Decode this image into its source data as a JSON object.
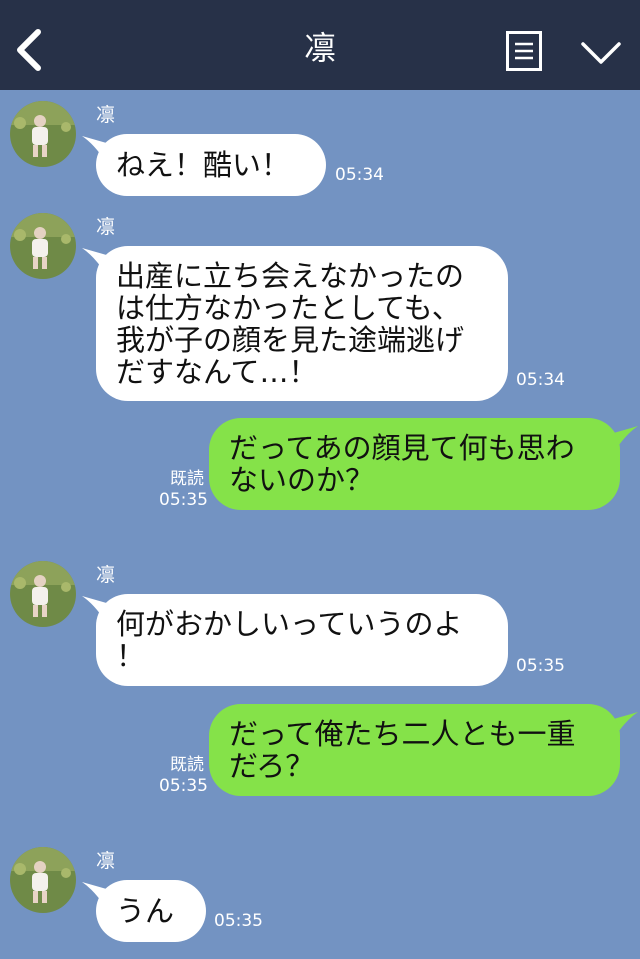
{
  "header": {
    "title": "凛",
    "back_icon": "chevron-left-icon",
    "menu_icon": "note-list-icon",
    "collapse_icon": "chevron-down-icon"
  },
  "colors": {
    "chat_background": "#7393c2",
    "header_background": "#273148",
    "incoming_bubble": "#ffffff",
    "outgoing_bubble": "#85e249"
  },
  "messages": [
    {
      "direction": "in",
      "sender": "凛",
      "text": "ねえ！酷い！",
      "time": "05:34"
    },
    {
      "direction": "in",
      "sender": "凛",
      "text": "出産に立ち会えなかったの\nは仕方なかったとしても、\n我が子の顔を見た途端逃げ\nだすなんて…！",
      "time": "05:34"
    },
    {
      "direction": "out",
      "read": "既読",
      "text": "だってあの顔見て何も思わ\nないのか？",
      "time": "05:35"
    },
    {
      "direction": "in",
      "sender": "凛",
      "text": "何がおかしいっていうのよ\n！",
      "time": "05:35"
    },
    {
      "direction": "out",
      "read": "既読",
      "text": "だって俺たち二人とも一重\nだろ？",
      "time": "05:35"
    },
    {
      "direction": "in",
      "sender": "凛",
      "text": "うん",
      "time": "05:35"
    }
  ]
}
